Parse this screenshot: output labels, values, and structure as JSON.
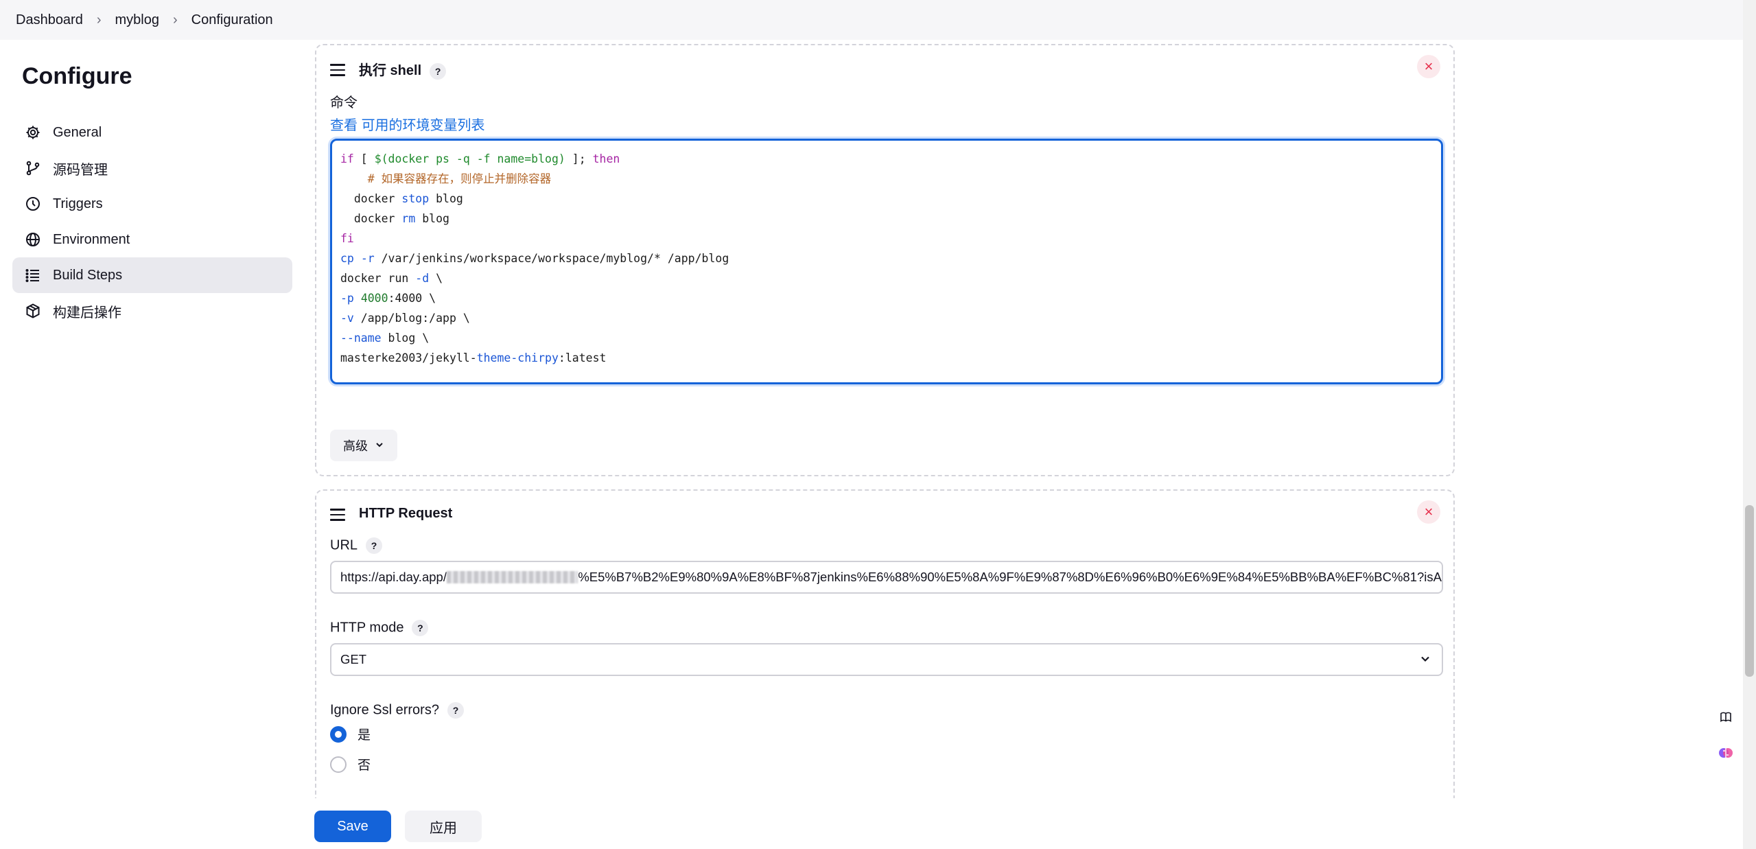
{
  "breadcrumb": [
    "Dashboard",
    "myblog",
    "Configuration"
  ],
  "sidebar": {
    "title": "Configure",
    "items": [
      {
        "label": "General",
        "icon": "gear-icon"
      },
      {
        "label": "源码管理",
        "icon": "branch-icon"
      },
      {
        "label": "Triggers",
        "icon": "clock-icon"
      },
      {
        "label": "Environment",
        "icon": "globe-icon"
      },
      {
        "label": "Build Steps",
        "icon": "list-icon",
        "active": true
      },
      {
        "label": "构建后操作",
        "icon": "package-icon"
      }
    ]
  },
  "shell_step": {
    "title": "执行 shell",
    "help": "?",
    "command_label": "命令",
    "env_link_prefix": "查看",
    "env_link_text": "可用的环境变量列表",
    "command_lines": [
      "if [ $(docker ps -q -f name=blog) ]; then",
      "  # 如果容器存在，则停止并删除容器",
      "  docker stop blog",
      "  docker rm blog",
      "fi",
      "cp -r /var/jenkins/workspace/workspace/myblog/* /app/blog",
      "docker run -d \\",
      "-p 4000:4000 \\",
      "-v /app/blog:/app \\",
      "--name blog \\",
      "masterke2003/jekyll-theme-chirpy:latest"
    ],
    "advanced_label": "高级"
  },
  "http_step": {
    "title": "HTTP Request",
    "url_label": "URL",
    "url_prefix": "https://api.day.app/",
    "url_suffix": "%E5%B7%B2%E9%80%9A%E8%BF%87jenkins%E6%88%90%E5%8A%9F%E9%87%8D%E6%96%B0%E6%9E%84%E5%BB%BA%EF%BC%81?isA",
    "mode_label": "HTTP mode",
    "mode_value": "GET",
    "ssl_label": "Ignore Ssl errors?",
    "ssl_options": [
      {
        "label": "是",
        "selected": true
      },
      {
        "label": "否",
        "selected": false
      }
    ]
  },
  "footer": {
    "save_label": "Save",
    "apply_label": "应用"
  },
  "colors": {
    "accent": "#1463d9",
    "danger": "#e6304c"
  }
}
